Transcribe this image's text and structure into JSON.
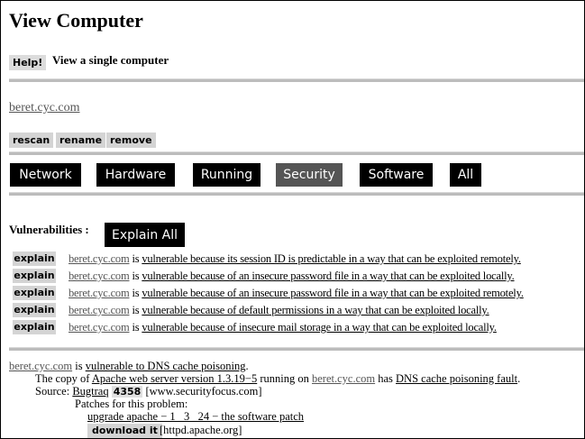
{
  "page": {
    "title": "View Computer",
    "help_label": "Help!",
    "subtitle": "View a single computer"
  },
  "computer": {
    "hostname": "beret.cyc.com",
    "actions": [
      "rescan",
      "rename",
      "remove"
    ]
  },
  "tabs": [
    {
      "label": "Network",
      "active": false
    },
    {
      "label": "Hardware",
      "active": false
    },
    {
      "label": "Running",
      "active": false
    },
    {
      "label": "Security",
      "active": true
    },
    {
      "label": "Software",
      "active": false
    },
    {
      "label": "All",
      "active": false
    }
  ],
  "vulnerabilities": {
    "label": "Vulnerabilities :",
    "explain_all_label": "Explain All",
    "explain_label": "explain",
    "connector": "is",
    "items": [
      {
        "host": "beret.cyc.com",
        "text": "vulnerable because its session ID is predictable in a way that can be exploited remotely."
      },
      {
        "host": "beret.cyc.com",
        "text": "vulnerable because of an insecure password file in a way that can be exploited locally."
      },
      {
        "host": "beret.cyc.com",
        "text": "vulnerable because of an insecure password file in a way that can be exploited remotely."
      },
      {
        "host": "beret.cyc.com",
        "text": "vulnerable because of default permissions in a way that can be exploited locally."
      },
      {
        "host": "beret.cyc.com",
        "text": "vulnerable because of insecure mail storage in a way that can be exploited locally."
      }
    ]
  },
  "detail": {
    "host": "beret.cyc.com",
    "is": "is",
    "vuln_link": "vulnerable to DNS cache poisoning",
    "period": ".",
    "copy_prefix": "The copy of",
    "software_link": "Apache web server version 1.3.19−5",
    "running_on": "running on",
    "running_host": "beret.cyc.com",
    "has": "has",
    "fault_link": "DNS cache poisoning fault",
    "source_label": "Source:",
    "source_link": "Bugtraq",
    "bugtraq_id": "4358",
    "source_site": "[www.securityfocus.com]",
    "patches_label": "Patches for this problem:",
    "patch_link": "upgrade apache − 1 _3 _24 − the software patch",
    "download_label": "download it",
    "download_site": "[httpd.apache.org]"
  }
}
